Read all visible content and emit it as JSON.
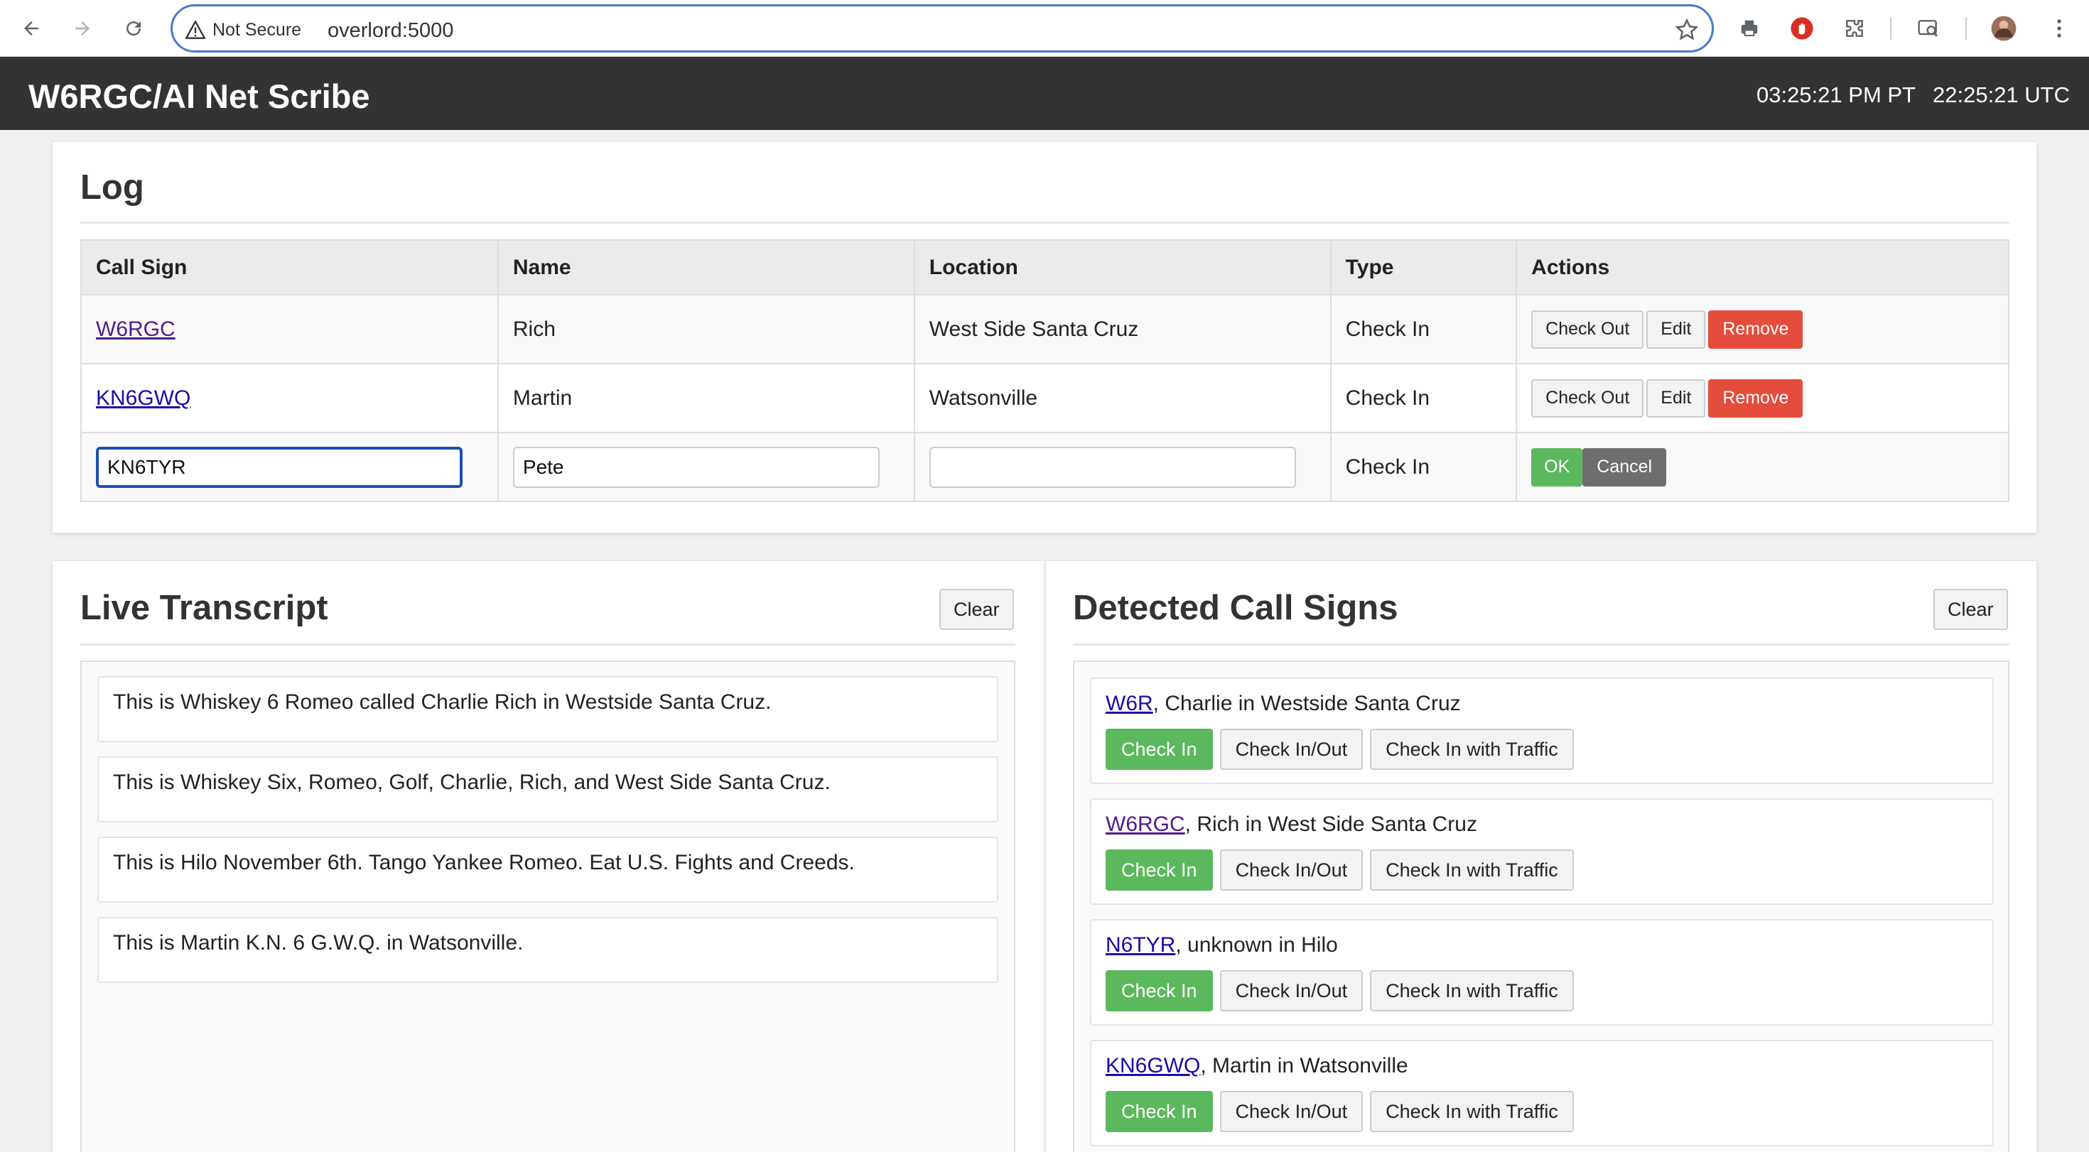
{
  "browser": {
    "security_label": "Not Secure",
    "url": "overlord:5000"
  },
  "header": {
    "title": "W6RGC/AI Net Scribe",
    "local_time": "03:25:21 PM PT",
    "utc_time": "22:25:21 UTC"
  },
  "log": {
    "title": "Log",
    "columns": [
      "Call Sign",
      "Name",
      "Location",
      "Type",
      "Actions"
    ],
    "rows": [
      {
        "call_sign": "W6RGC",
        "name": "Rich",
        "location": "West Side Santa Cruz",
        "type": "Check In"
      },
      {
        "call_sign": "KN6GWQ",
        "name": "Martin",
        "location": "Watsonville",
        "type": "Check In"
      }
    ],
    "row_buttons": {
      "check_out": "Check Out",
      "edit": "Edit",
      "remove": "Remove"
    },
    "edit_row": {
      "call_sign_value": "KN6TYR",
      "name_value": "Pete",
      "location_value": "",
      "type": "Check In",
      "ok": "OK",
      "cancel": "Cancel"
    }
  },
  "transcript": {
    "title": "Live Transcript",
    "clear": "Clear",
    "items": [
      "This is Whiskey 6 Romeo called Charlie Rich in Westside Santa Cruz.",
      "This is Whiskey Six, Romeo, Golf, Charlie, Rich, and West Side Santa Cruz.",
      "This is Hilo November 6th. Tango Yankee Romeo. Eat U.S. Fights and Creeds.",
      "This is Martin K.N. 6 G.W.Q. in Watsonville."
    ]
  },
  "detected": {
    "title": "Detected Call Signs",
    "clear": "Clear",
    "buttons": {
      "check_in": "Check In",
      "check_in_out": "Check In/Out",
      "check_in_traffic": "Check In with Traffic"
    },
    "items": [
      {
        "call_sign": "W6R",
        "detail": ", Charlie in Westside Santa Cruz"
      },
      {
        "call_sign": "W6RGC",
        "detail": ", Rich in West Side Santa Cruz"
      },
      {
        "call_sign": "N6TYR",
        "detail": ", unknown in Hilo"
      },
      {
        "call_sign": "KN6GWQ",
        "detail": ", Martin in Watsonville"
      }
    ]
  },
  "colors": {
    "header_bg": "#333333",
    "remove": "#e44c3c",
    "ok": "#5cb85c",
    "cancel": "#6e6e6e",
    "link": "#1a0dab"
  }
}
